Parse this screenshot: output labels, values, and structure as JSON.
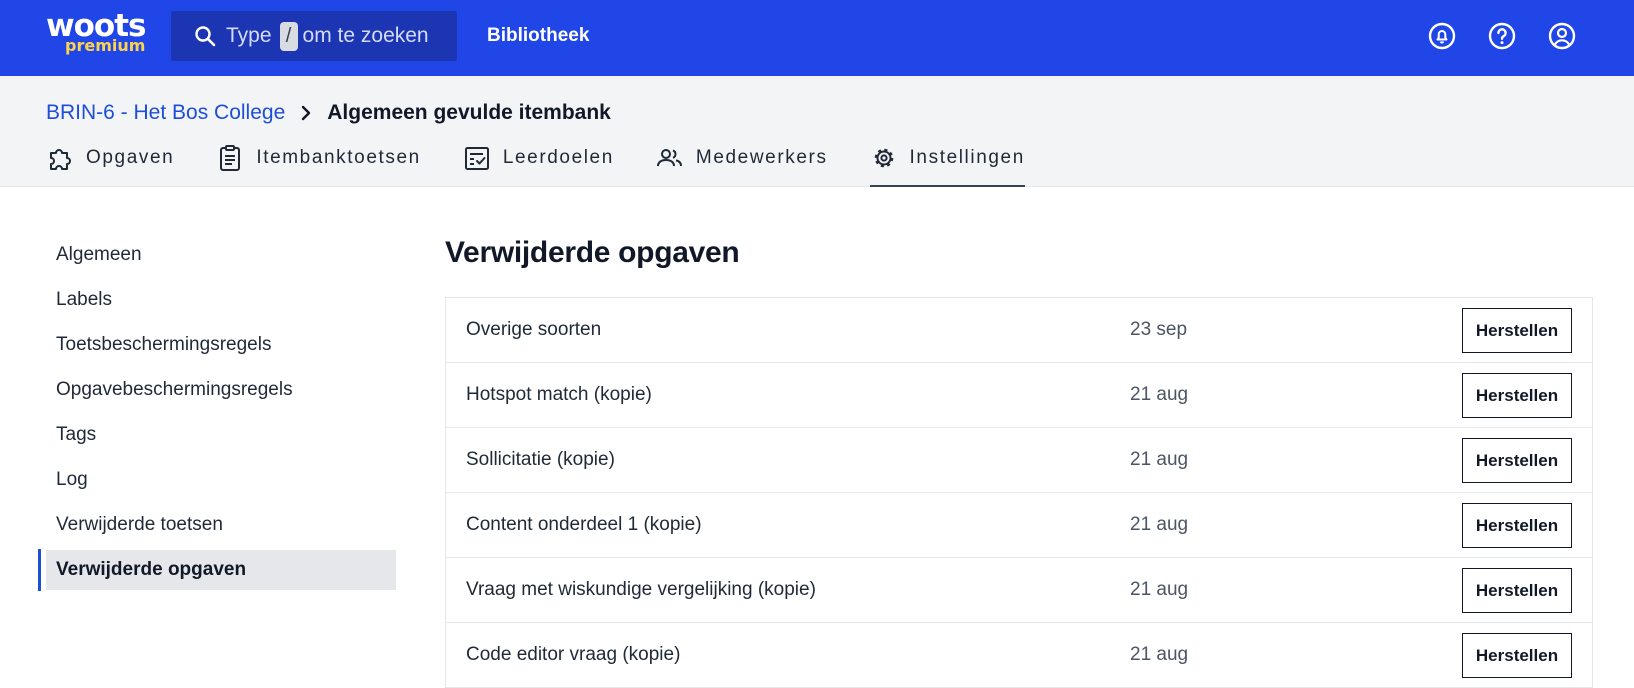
{
  "topbar": {
    "logo_word": "woots",
    "logo_sub": "premium",
    "search_prefix": "Type",
    "search_key": "/",
    "search_suffix": "om te zoeken",
    "nav_library": "Bibliotheek",
    "icons": [
      "notifications-icon",
      "help-icon",
      "account-icon"
    ]
  },
  "breadcrumb": {
    "parent": "BRIN-6 - Het Bos College",
    "current": "Algemeen gevulde itembank"
  },
  "tabs": [
    {
      "label": "Opgaven",
      "icon": "puzzle-icon"
    },
    {
      "label": "Itembanktoetsen",
      "icon": "clipboard-icon"
    },
    {
      "label": "Leerdoelen",
      "icon": "checklist-icon"
    },
    {
      "label": "Medewerkers",
      "icon": "people-icon"
    },
    {
      "label": "Instellingen",
      "icon": "gear-icon",
      "active": true
    }
  ],
  "sidebar": {
    "items": [
      {
        "label": "Algemeen"
      },
      {
        "label": "Labels"
      },
      {
        "label": "Toetsbeschermingsregels"
      },
      {
        "label": "Opgavebeschermingsregels"
      },
      {
        "label": "Tags"
      },
      {
        "label": "Log"
      },
      {
        "label": "Verwijderde toetsen"
      },
      {
        "label": "Verwijderde opgaven",
        "active": true
      }
    ]
  },
  "main": {
    "title": "Verwijderde opgaven",
    "restore_label": "Herstellen",
    "rows": [
      {
        "name": "Overige soorten",
        "date": "23 sep"
      },
      {
        "name": "Hotspot match (kopie)",
        "date": "21 aug"
      },
      {
        "name": "Sollicitatie (kopie)",
        "date": "21 aug"
      },
      {
        "name": "Content onderdeel 1 (kopie)",
        "date": "21 aug"
      },
      {
        "name": "Vraag met wiskundige vergelijking (kopie)",
        "date": "21 aug"
      },
      {
        "name": "Code editor vraag (kopie)",
        "date": "21 aug"
      }
    ]
  },
  "colors": {
    "brand_blue": "#2146e8",
    "search_bg": "#1c36b3",
    "logo_sub": "#fcd34d",
    "link_blue": "#1d4ed8"
  }
}
